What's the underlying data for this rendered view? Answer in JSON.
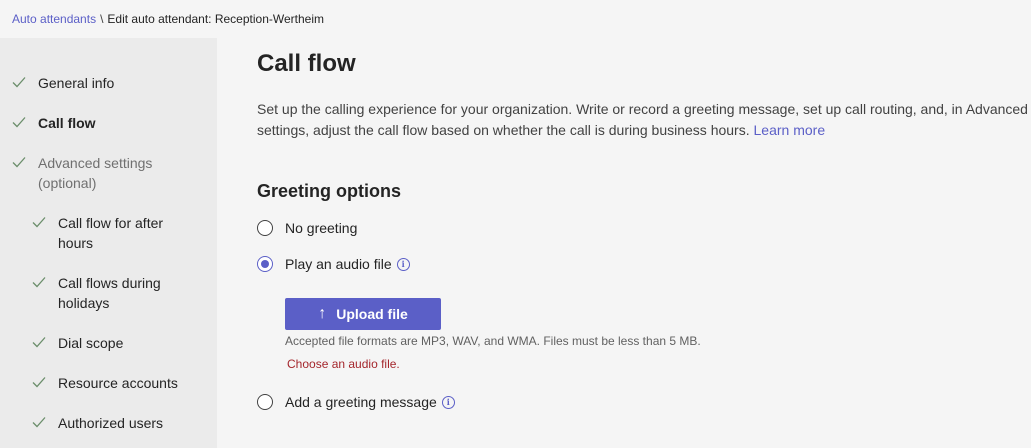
{
  "breadcrumb": {
    "link": "Auto attendants",
    "separator": "\\",
    "current": "Edit auto attendant: Reception-Wertheim"
  },
  "sidebar": {
    "items": [
      {
        "label": "General info",
        "state": "done"
      },
      {
        "label": "Call flow",
        "state": "active"
      },
      {
        "label": "Advanced settings (optional)",
        "state": "muted"
      },
      {
        "label": "Call flow for after hours",
        "state": "done"
      },
      {
        "label": "Call flows during holidays",
        "state": "done"
      },
      {
        "label": "Dial scope",
        "state": "done"
      },
      {
        "label": "Resource accounts",
        "state": "done"
      },
      {
        "label": "Authorized users",
        "state": "done"
      }
    ]
  },
  "main": {
    "title": "Call flow",
    "description": "Set up the calling experience for your organization. Write or record a greeting message, set up call routing, and, in Advanced settings, adjust the call flow based on whether the call is during business hours.",
    "learn_more": "Learn more",
    "section_title": "Greeting options",
    "options": [
      {
        "label": "No greeting",
        "selected": false,
        "info": false
      },
      {
        "label": "Play an audio file",
        "selected": true,
        "info": true
      },
      {
        "label": "Add a greeting message",
        "selected": false,
        "info": true
      }
    ],
    "upload_label": "Upload file",
    "upload_hint": "Accepted file formats are MP3, WAV, and WMA. Files must be less than 5 MB.",
    "error": "Choose an audio file."
  },
  "colors": {
    "accent": "#5b5fc7",
    "check": "#6b8e6b",
    "error": "#a4262c"
  },
  "icons": {
    "check": "check-icon",
    "info": "info-icon",
    "upload": "upload-arrow-icon"
  }
}
